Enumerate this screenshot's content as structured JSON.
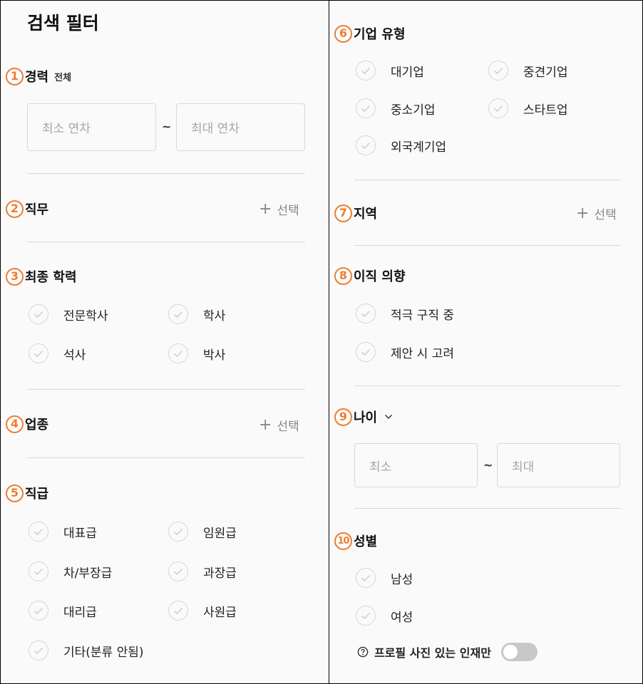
{
  "page_title": "검색 필터",
  "sections": {
    "career": {
      "number": "1",
      "title": "경력",
      "sub": "전체",
      "min_placeholder": "최소 연차",
      "max_placeholder": "최대 연차",
      "separator": "~"
    },
    "job": {
      "number": "2",
      "title": "직무",
      "action": "선택"
    },
    "education": {
      "number": "3",
      "title": "최종 학력",
      "options": [
        "전문학사",
        "학사",
        "석사",
        "박사"
      ]
    },
    "industry": {
      "number": "4",
      "title": "업종",
      "action": "선택"
    },
    "position": {
      "number": "5",
      "title": "직급",
      "options": [
        "대표급",
        "임원급",
        "차/부장급",
        "과장급",
        "대리급",
        "사원급",
        "기타(분류 안됨)"
      ]
    },
    "company_type": {
      "number": "6",
      "title": "기업 유형",
      "options": [
        "대기업",
        "중견기업",
        "중소기업",
        "스타트업",
        "외국계기업"
      ]
    },
    "region": {
      "number": "7",
      "title": "지역",
      "action": "선택"
    },
    "intent": {
      "number": "8",
      "title": "이직 의향",
      "options": [
        "적극 구직 중",
        "제안 시 고려"
      ]
    },
    "age": {
      "number": "9",
      "title": "나이",
      "min_placeholder": "최소",
      "max_placeholder": "최대",
      "separator": "~"
    },
    "gender": {
      "number": "10",
      "title": "성별",
      "options": [
        "남성",
        "여성"
      ]
    }
  },
  "photo_toggle": {
    "label": "프로필 사진 있는 인재만",
    "enabled": false
  },
  "icons": {
    "option": "check-circle-icon",
    "add": "plus-icon",
    "expand": "chevron-down-icon",
    "help": "question-circle-icon"
  },
  "colors": {
    "badge": "#ed7d31",
    "border": "#d9d9d9",
    "placeholder": "#a6a6a6",
    "toggle_off": "#c8c8c8"
  }
}
